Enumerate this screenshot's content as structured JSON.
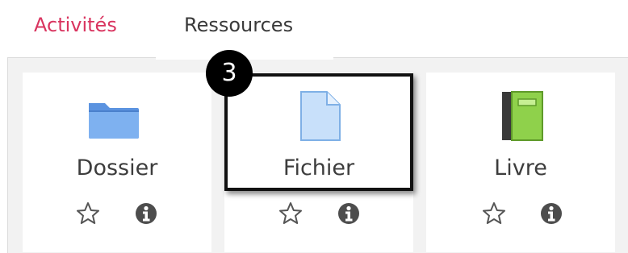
{
  "tabs": {
    "activites": "Activités",
    "ressources": "Ressources"
  },
  "colors": {
    "active_tab": "#d9345f",
    "folder": "#5b93e0",
    "book": "#8fd14b",
    "icon_gray": "#4d4d4d"
  },
  "cards": [
    {
      "label": "Dossier",
      "icon": "folder-icon"
    },
    {
      "label": "Fichier",
      "icon": "file-icon"
    },
    {
      "label": "Livre",
      "icon": "book-icon"
    }
  ],
  "callout": {
    "number": "3"
  }
}
